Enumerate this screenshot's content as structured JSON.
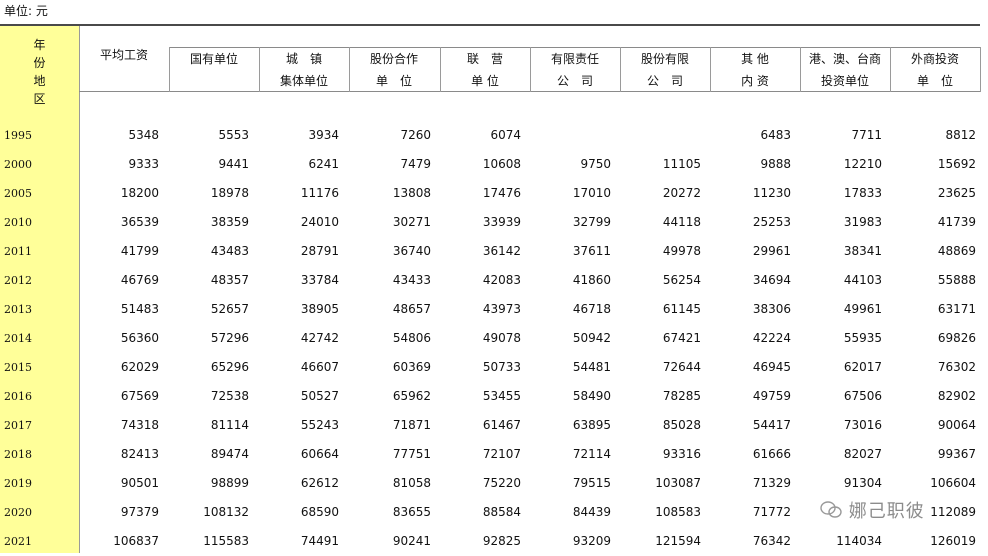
{
  "unit_label": "单位: 元",
  "header": {
    "region_line1": "年 份",
    "region_line2": "地 区",
    "avg_wage": "平均工资",
    "columns": [
      {
        "l1": "国有单位",
        "l2": ""
      },
      {
        "l1": "城　镇",
        "l2": "集体单位"
      },
      {
        "l1": "股份合作",
        "l2": "单　位"
      },
      {
        "l1": "联　营",
        "l2": "单 位"
      },
      {
        "l1": "有限责任",
        "l2": "公　司"
      },
      {
        "l1": "股份有限",
        "l2": "公　司"
      },
      {
        "l1": "其 他",
        "l2": "内 资"
      },
      {
        "l1": "港、澳、台商",
        "l2": "投资单位"
      },
      {
        "l1": "外商投资",
        "l2": "单　位"
      }
    ]
  },
  "rows": [
    {
      "year": "1995",
      "values": [
        "5348",
        "5553",
        "3934",
        "7260",
        "6074",
        "",
        "",
        "6483",
        "7711",
        "8812"
      ]
    },
    {
      "year": "2000",
      "values": [
        "9333",
        "9441",
        "6241",
        "7479",
        "10608",
        "9750",
        "11105",
        "9888",
        "12210",
        "15692"
      ]
    },
    {
      "year": "2005",
      "values": [
        "18200",
        "18978",
        "11176",
        "13808",
        "17476",
        "17010",
        "20272",
        "11230",
        "17833",
        "23625"
      ]
    },
    {
      "year": "2010",
      "values": [
        "36539",
        "38359",
        "24010",
        "30271",
        "33939",
        "32799",
        "44118",
        "25253",
        "31983",
        "41739"
      ]
    },
    {
      "year": "2011",
      "values": [
        "41799",
        "43483",
        "28791",
        "36740",
        "36142",
        "37611",
        "49978",
        "29961",
        "38341",
        "48869"
      ]
    },
    {
      "year": "2012",
      "values": [
        "46769",
        "48357",
        "33784",
        "43433",
        "42083",
        "41860",
        "56254",
        "34694",
        "44103",
        "55888"
      ]
    },
    {
      "year": "2013",
      "values": [
        "51483",
        "52657",
        "38905",
        "48657",
        "43973",
        "46718",
        "61145",
        "38306",
        "49961",
        "63171"
      ]
    },
    {
      "year": "2014",
      "values": [
        "56360",
        "57296",
        "42742",
        "54806",
        "49078",
        "50942",
        "67421",
        "42224",
        "55935",
        "69826"
      ]
    },
    {
      "year": "2015",
      "values": [
        "62029",
        "65296",
        "46607",
        "60369",
        "50733",
        "54481",
        "72644",
        "46945",
        "62017",
        "76302"
      ]
    },
    {
      "year": "2016",
      "values": [
        "67569",
        "72538",
        "50527",
        "65962",
        "53455",
        "58490",
        "78285",
        "49759",
        "67506",
        "82902"
      ]
    },
    {
      "year": "2017",
      "values": [
        "74318",
        "81114",
        "55243",
        "71871",
        "61467",
        "63895",
        "85028",
        "54417",
        "73016",
        "90064"
      ]
    },
    {
      "year": "2018",
      "values": [
        "82413",
        "89474",
        "60664",
        "77751",
        "72107",
        "72114",
        "93316",
        "61666",
        "82027",
        "99367"
      ]
    },
    {
      "year": "2019",
      "values": [
        "90501",
        "98899",
        "62612",
        "81058",
        "75220",
        "79515",
        "103087",
        "71329",
        "91304",
        "106604"
      ]
    },
    {
      "year": "2020",
      "values": [
        "97379",
        "108132",
        "68590",
        "83655",
        "88584",
        "84439",
        "108583",
        "71772",
        "",
        "112089"
      ]
    },
    {
      "year": "2021",
      "values": [
        "106837",
        "115583",
        "74491",
        "90241",
        "92825",
        "93209",
        "121594",
        "76342",
        "114034",
        "126019"
      ]
    }
  ],
  "watermark": "娜己职彼"
}
